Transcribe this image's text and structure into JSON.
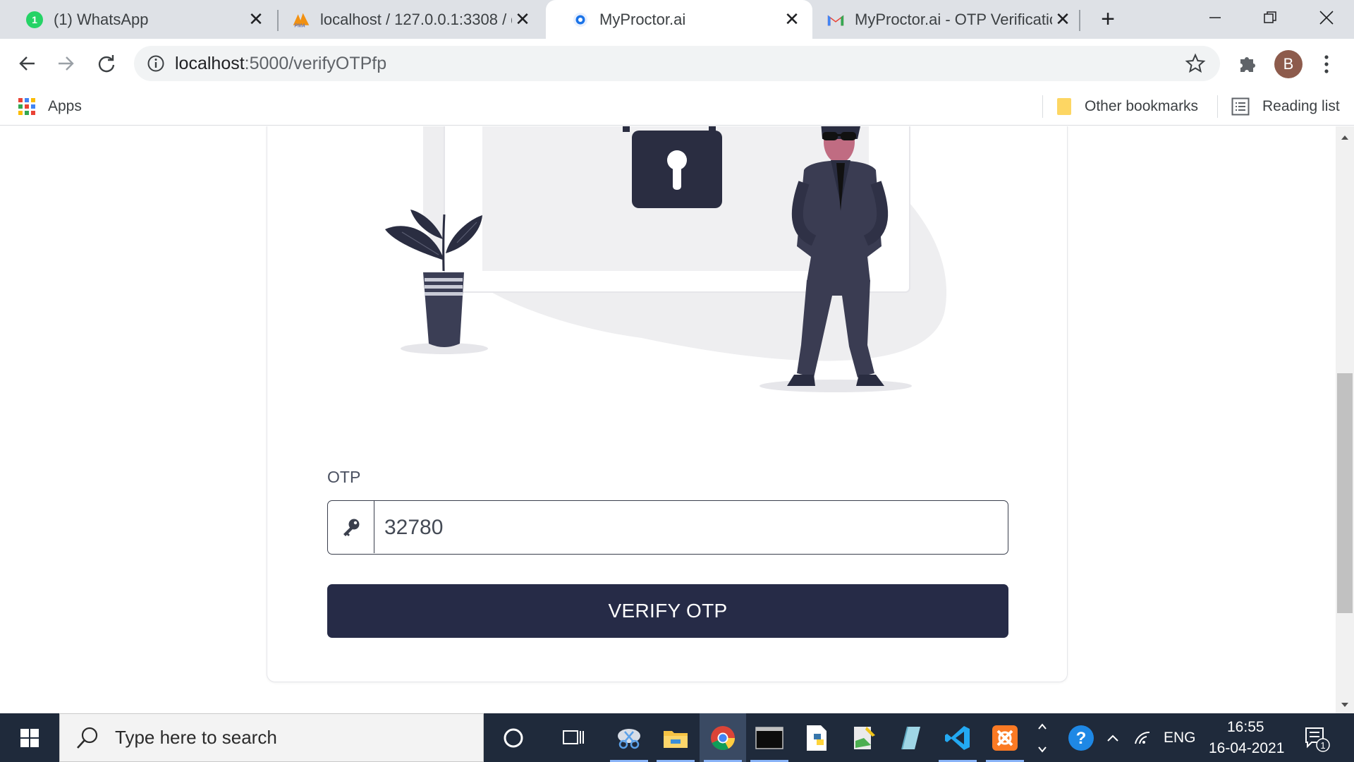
{
  "tabs": [
    {
      "title": "(1) WhatsApp",
      "favicon": "whatsapp-icon",
      "badge": "1",
      "active": false
    },
    {
      "title": "localhost / 127.0.0.1:3308 / q",
      "favicon": "phpmyadmin-icon",
      "active": false
    },
    {
      "title": "MyProctor.ai",
      "favicon": "chrome-page-icon",
      "active": true
    },
    {
      "title": "MyProctor.ai - OTP Verificatio",
      "favicon": "gmail-icon",
      "active": false
    }
  ],
  "omnibox": {
    "host": "localhost",
    "path": ":5000/verifyOTPfp"
  },
  "profile": {
    "initial": "B",
    "color": "#8d5b4c"
  },
  "bookmarks": {
    "apps": "Apps",
    "other": "Other bookmarks",
    "reading": "Reading list"
  },
  "form": {
    "otp_label": "OTP",
    "otp_value": "32780",
    "button_label": "VERIFY OTP",
    "button_color": "#262b47"
  },
  "taskbar": {
    "search_placeholder": "Type here to search",
    "language": "ENG",
    "time": "16:55",
    "date": "16-04-2021",
    "notification_count": "1"
  }
}
